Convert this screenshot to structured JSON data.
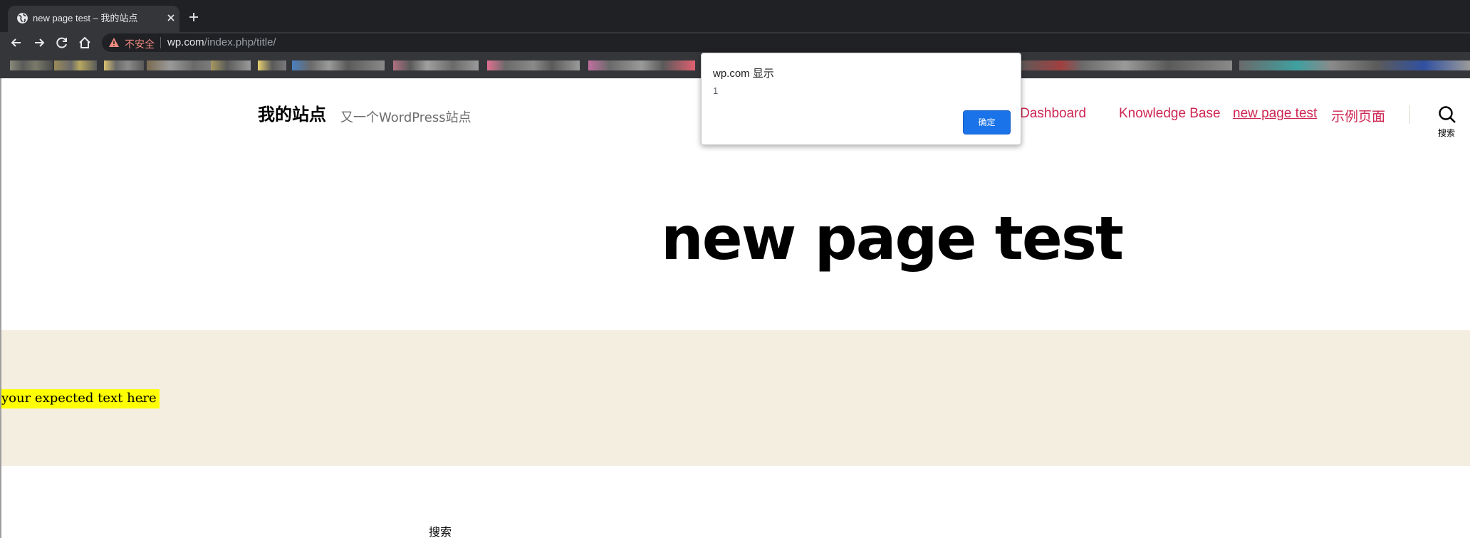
{
  "browser": {
    "tab": {
      "title": "new page test – 我的站点",
      "favicon": "globe-icon"
    },
    "address_bar": {
      "security_label": "不安全",
      "url_host": "wp.com",
      "url_path": "/index.php/title/"
    },
    "icons": [
      "back-icon",
      "forward-icon",
      "reload-icon",
      "home-icon",
      "warning-icon",
      "close-icon",
      "plus-icon"
    ]
  },
  "site": {
    "title": "我的站点",
    "description": "又一个WordPress站点",
    "nav": [
      {
        "label": "nt Dashboard"
      },
      {
        "label": "Knowledge Base"
      },
      {
        "label": "new page test",
        "current": true
      },
      {
        "label": "示例页面"
      }
    ],
    "search_toggle_label": "搜索",
    "accent_color": "#cd2653"
  },
  "page": {
    "title": "new page test",
    "highlighted_text": "your expected text here",
    "trailing_text": ".",
    "footer_search_label": "搜索",
    "band_color": "#f3eee0",
    "highlight_color": "#ffff00"
  },
  "dialog": {
    "title": "wp.com 显示",
    "message": "1",
    "ok_label": "确定",
    "ok_color": "#1a73e8"
  }
}
